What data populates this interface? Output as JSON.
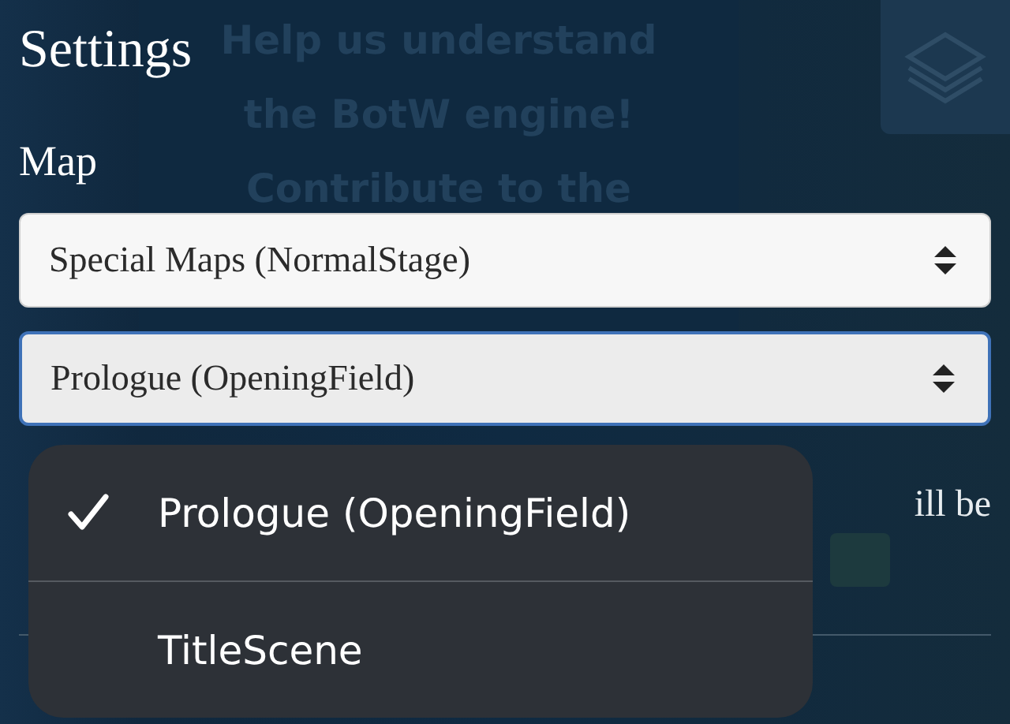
{
  "banner": {
    "lines": [
      "Help us understand",
      "the BotW engine!",
      "Contribute to the"
    ]
  },
  "title": "Settings",
  "map_label": "Map",
  "selects": [
    {
      "value": "Special Maps (NormalStage)",
      "focused": false
    },
    {
      "value": "Prologue (OpeningField)",
      "focused": true
    }
  ],
  "note_fragment": "ill be",
  "menu": [
    {
      "label": "Prologue (OpeningField)",
      "selected": true
    },
    {
      "label": "TitleScene",
      "selected": false
    }
  ]
}
